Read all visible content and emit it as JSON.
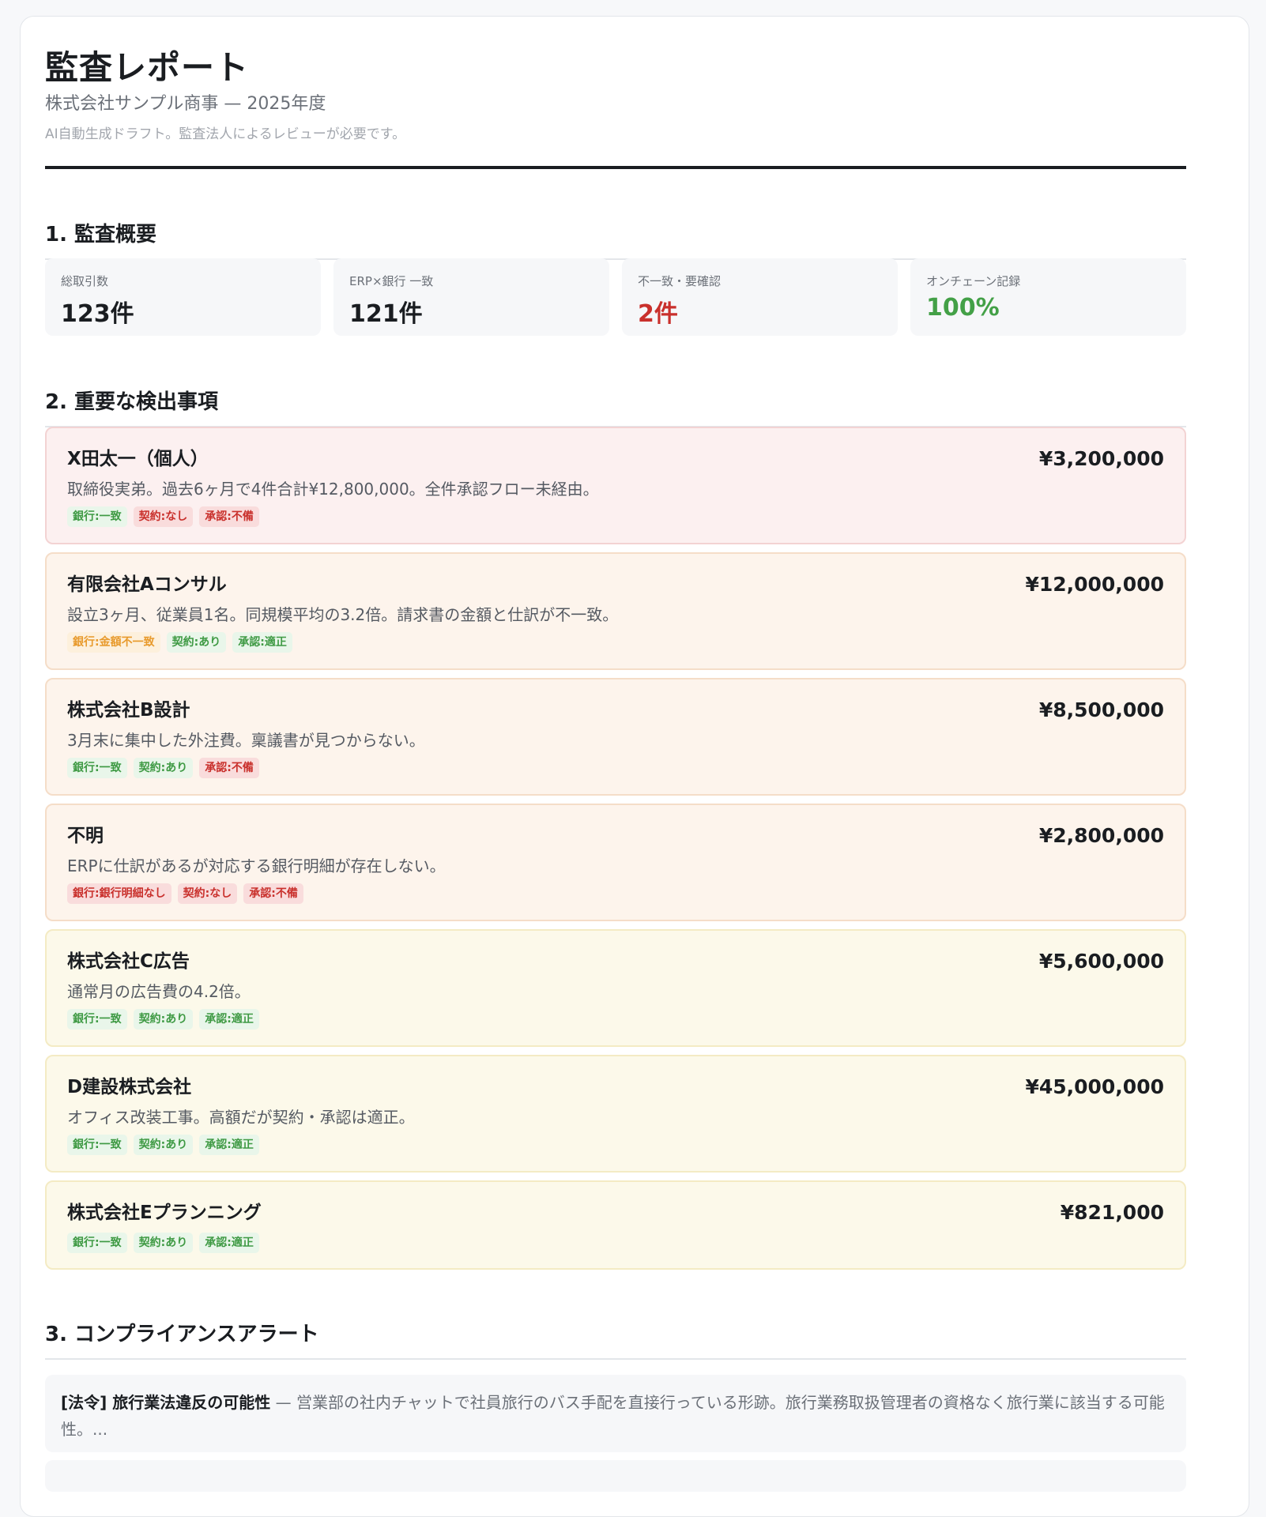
{
  "header": {
    "title": "監査レポート",
    "subtitle": "株式会社サンプル商事 — 2025年度",
    "note": "AI自動生成ドラフト。監査法人によるレビューが必要です。"
  },
  "sections": {
    "overview": "1. 監査概要",
    "findings": "2. 重要な検出事項",
    "alerts": "3. コンプライアンスアラート"
  },
  "kpis": [
    {
      "label": "総取引数",
      "value": "123件"
    },
    {
      "label": "ERP×銀行 一致",
      "value": "121件"
    },
    {
      "label": "不一致・要確認",
      "value": "2件",
      "color": "#c9302c"
    },
    {
      "label": "オンチェーン記録",
      "value": "100%",
      "color": "#43a047"
    }
  ],
  "findings": [
    {
      "name": "X田太一（個人）",
      "amount": "¥3,200,000",
      "desc": "取締役実弟。過去6ヶ月で4件合計¥12,800,000。全件承認フロー未経由。",
      "severity": "high",
      "tags": [
        {
          "label": "銀行:一致",
          "status": "ok"
        },
        {
          "label": "契約:なし",
          "status": "bad"
        },
        {
          "label": "承認:不備",
          "status": "bad"
        }
      ]
    },
    {
      "name": "有限会社Aコンサル",
      "amount": "¥12,000,000",
      "desc": "設立3ヶ月、従業員1名。同規模平均の3.2倍。請求書の金額と仕訳が不一致。",
      "severity": "mid",
      "tags": [
        {
          "label": "銀行:金額不一致",
          "status": "warn"
        },
        {
          "label": "契約:あり",
          "status": "ok"
        },
        {
          "label": "承認:適正",
          "status": "ok"
        }
      ]
    },
    {
      "name": "株式会社B設計",
      "amount": "¥8,500,000",
      "desc": "3月末に集中した外注費。稟議書が見つからない。",
      "severity": "mid",
      "tags": [
        {
          "label": "銀行:一致",
          "status": "ok"
        },
        {
          "label": "契約:あり",
          "status": "ok"
        },
        {
          "label": "承認:不備",
          "status": "bad"
        }
      ]
    },
    {
      "name": "不明",
      "amount": "¥2,800,000",
      "desc": "ERPに仕訳があるが対応する銀行明細が存在しない。",
      "severity": "mid",
      "tags": [
        {
          "label": "銀行:銀行明細なし",
          "status": "bad"
        },
        {
          "label": "契約:なし",
          "status": "bad"
        },
        {
          "label": "承認:不備",
          "status": "bad"
        }
      ]
    },
    {
      "name": "株式会社C広告",
      "amount": "¥5,600,000",
      "desc": "通常月の広告費の4.2倍。",
      "severity": "low",
      "tags": [
        {
          "label": "銀行:一致",
          "status": "ok"
        },
        {
          "label": "契約:あり",
          "status": "ok"
        },
        {
          "label": "承認:適正",
          "status": "ok"
        }
      ]
    },
    {
      "name": "D建設株式会社",
      "amount": "¥45,000,000",
      "desc": "オフィス改装工事。高額だが契約・承認は適正。",
      "severity": "low",
      "tags": [
        {
          "label": "銀行:一致",
          "status": "ok"
        },
        {
          "label": "契約:あり",
          "status": "ok"
        },
        {
          "label": "承認:適正",
          "status": "ok"
        }
      ]
    },
    {
      "name": "株式会社Eプランニング",
      "amount": "¥821,000",
      "desc": "",
      "severity": "low",
      "tags": [
        {
          "label": "銀行:一致",
          "status": "ok"
        },
        {
          "label": "契約:あり",
          "status": "ok"
        },
        {
          "label": "承認:適正",
          "status": "ok"
        }
      ]
    }
  ],
  "alerts": [
    {
      "title": "[法令] 旅行業法違反の可能性",
      "separator": " — ",
      "text": "営業部の社内チャットで社員旅行のバス手配を直接行っている形跡。旅行業務取扱管理者の資格なく旅行業に該当する可能性。..."
    }
  ]
}
